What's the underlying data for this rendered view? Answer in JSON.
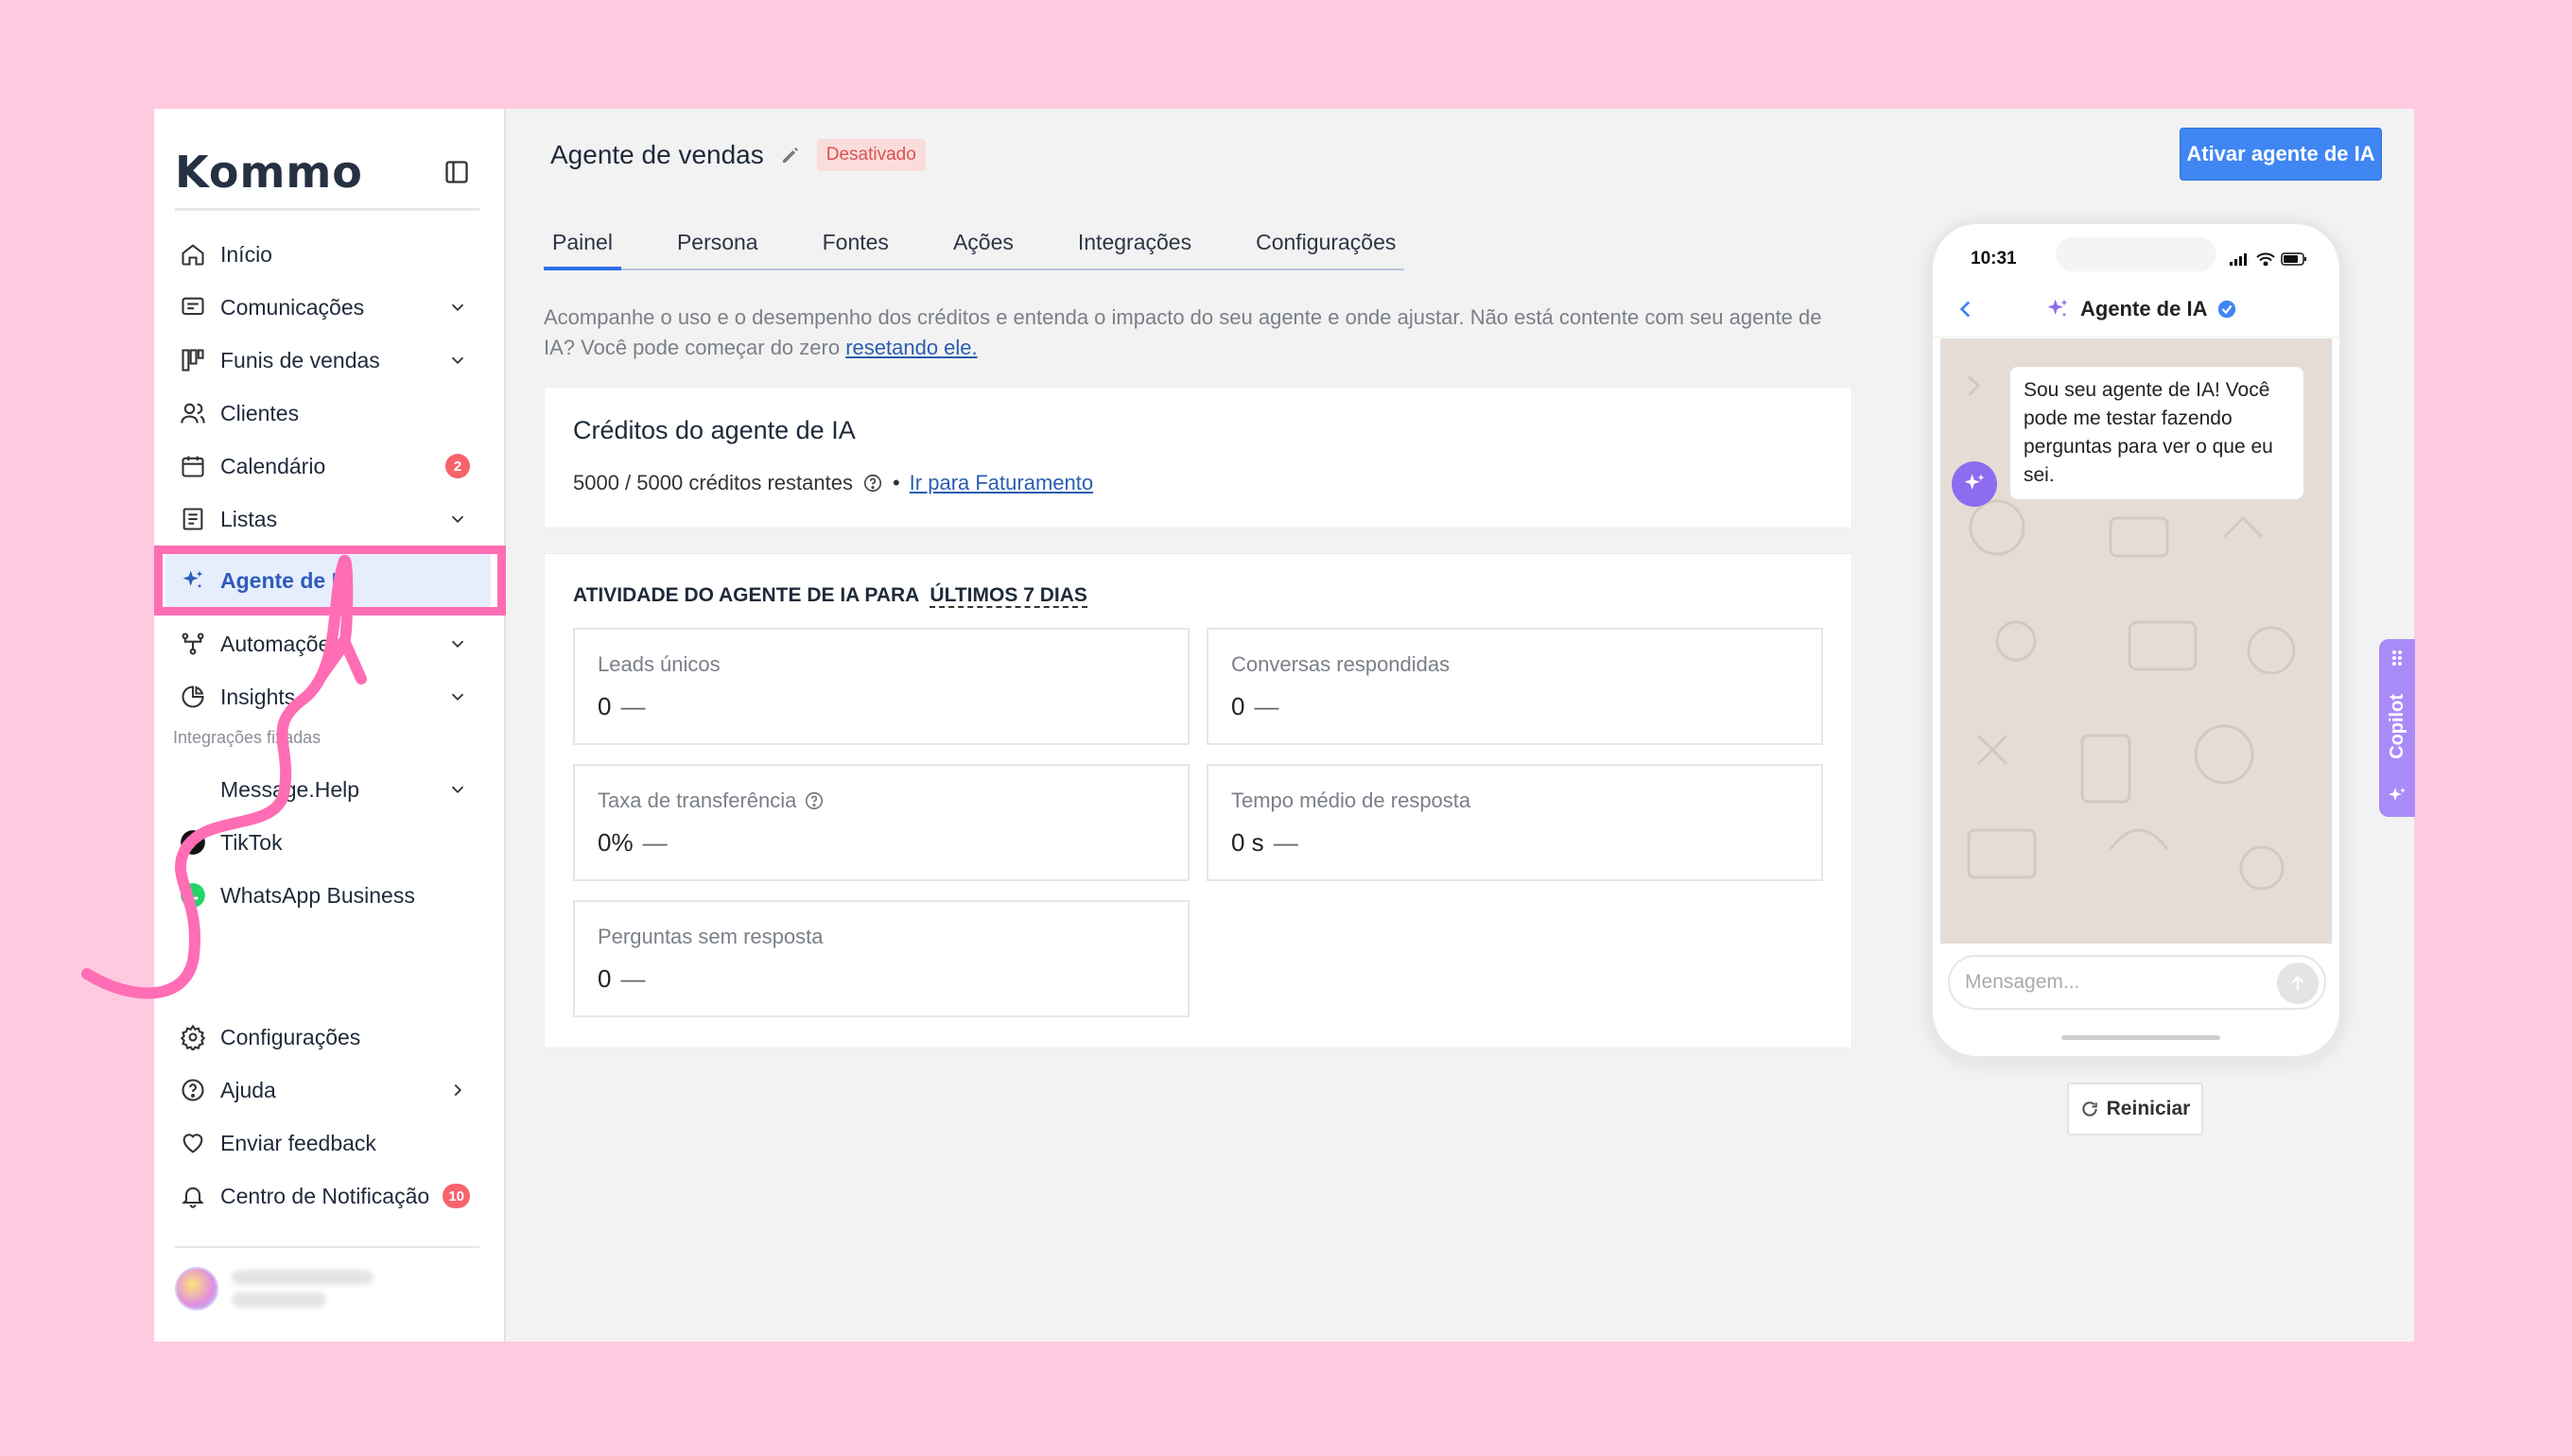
{
  "sidebar": {
    "logo": "Kommo",
    "items": [
      {
        "label": "Início",
        "icon": "home-icon"
      },
      {
        "label": "Comunicações",
        "icon": "chat-icon"
      },
      {
        "label": "Funis de vendas",
        "icon": "pipeline-icon"
      },
      {
        "label": "Clientes",
        "icon": "users-icon"
      },
      {
        "label": "Calendário",
        "icon": "calendar-icon",
        "badge": "2"
      },
      {
        "label": "Listas",
        "icon": "list-icon"
      },
      {
        "label": "Agente de IA",
        "icon": "sparkle-icon"
      },
      {
        "label": "Automações",
        "icon": "automation-icon"
      },
      {
        "label": "Insights",
        "icon": "chart-icon"
      }
    ],
    "section_label": "Integrações fixadas",
    "integrations": [
      {
        "label": "Message.Help"
      },
      {
        "label": "TikTok",
        "icon": "tiktok-icon"
      },
      {
        "label": "WhatsApp Business",
        "icon": "whatsapp-icon"
      }
    ],
    "bottom_items": [
      {
        "label": "Configurações",
        "icon": "gear-icon"
      },
      {
        "label": "Ajuda",
        "icon": "help-icon"
      },
      {
        "label": "Enviar feedback",
        "icon": "heart-icon"
      },
      {
        "label": "Centro de Notificação",
        "icon": "bell-icon",
        "badge": "10"
      }
    ]
  },
  "header": {
    "title": "Agente de vendas",
    "status": "Desativado",
    "primary_button": "Ativar agente de IA"
  },
  "tabs": [
    "Painel",
    "Persona",
    "Fontes",
    "Ações",
    "Integrações",
    "Configurações"
  ],
  "description": {
    "text": "Acompanhe o uso e o desempenho dos créditos e entenda o impacto do seu agente e onde ajustar. Não está contente com seu agente de IA? Você pode começar do zero ",
    "link": "resetando ele."
  },
  "credits": {
    "title": "Créditos do agente de IA",
    "remaining": "5000 / 5000 créditos restantes",
    "separator": "•",
    "billing_link": "Ir para Faturamento"
  },
  "activity": {
    "title": "ATIVIDADE DO AGENTE DE IA PARA",
    "period": "ÚLTIMOS 7 DIAS",
    "stats": [
      {
        "label": "Leads únicos",
        "value": "0",
        "trend": "—"
      },
      {
        "label": "Conversas respondidas",
        "value": "0",
        "trend": "—"
      },
      {
        "label": "Taxa de transferência",
        "value": "0%",
        "trend": "—"
      },
      {
        "label": "Tempo médio de resposta",
        "value": "0 s",
        "trend": "—"
      },
      {
        "label": "Perguntas sem resposta",
        "value": "0",
        "trend": "—"
      }
    ]
  },
  "phone": {
    "time": "10:31",
    "chat_title": "Agente de IA",
    "bot_message": "Sou seu agente de IA! Você pode me testar fazendo perguntas para ver o que eu sei.",
    "input_placeholder": "Mensagem..."
  },
  "reset_button": "Reiniciar",
  "copilot_label": "Copilot",
  "colors": {
    "background": "#fecae0",
    "accent": "#3f86f3",
    "highlight": "#ff6db4",
    "badge": "#f6636b"
  }
}
